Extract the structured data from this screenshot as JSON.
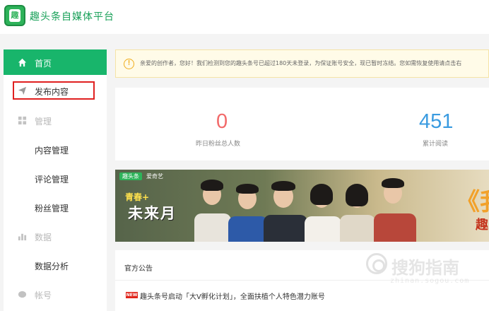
{
  "app": {
    "logo_char": "趣",
    "brand": "趣头条自媒体平台"
  },
  "sidebar": {
    "home": {
      "label": "首页",
      "icon": "home-icon"
    },
    "publish": {
      "label": "发布内容",
      "icon": "paper-plane-icon"
    },
    "manage": {
      "label": "管理",
      "icon": "grid-icon"
    },
    "manage_items": [
      "内容管理",
      "评论管理",
      "粉丝管理"
    ],
    "data": {
      "label": "数据",
      "icon": "bar-chart-icon"
    },
    "data_items": [
      "数据分析"
    ],
    "account": {
      "label": "帐号",
      "icon": "account-icon"
    }
  },
  "notice": {
    "icon": "warning-icon",
    "text": "亲爱的创作者，您好！我们检测到您的趣头条号已超过180天未登录，为保证账号安全，现已暂时冻结。您如需恢复使用请点击右"
  },
  "stats": {
    "fans_value": "0",
    "fans_label": "昨日粉丝总人数",
    "reads_value": "451",
    "reads_label": "累计阅读"
  },
  "banner": {
    "brand_left": "趣头条",
    "brand_right": "爱奇艺",
    "title_small": "青春+",
    "title_large": "未来月",
    "right_big": "《我",
    "right_small": "趣"
  },
  "announcements": {
    "title": "官方公告",
    "badge": "NEW",
    "items": [
      "趣头条号启动「大V孵化计划」，全面扶植个人特色潜力账号"
    ]
  },
  "watermark": {
    "text": "搜狗指南",
    "sub": "zhinan.sogou.com"
  },
  "colors": {
    "accent_green": "#18b56b",
    "brand_green": "#2eb35a",
    "highlight_red": "#e02020",
    "fans_red": "#f26a6a",
    "reads_blue": "#3a9be0"
  }
}
